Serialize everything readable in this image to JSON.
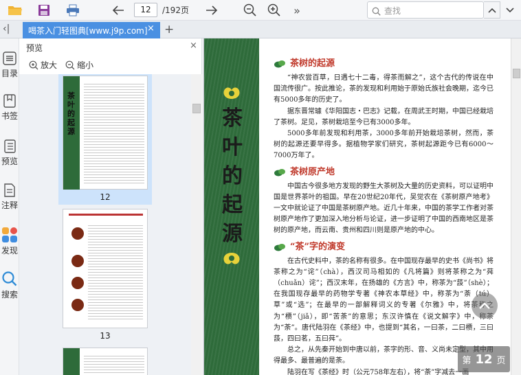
{
  "toolbar": {
    "page_current": "12",
    "page_total": "/192页",
    "search_placeholder": "查找",
    "more": "»"
  },
  "tabs": [
    {
      "label": "喝茶入门轻图典[www.j9p.com]",
      "close": "×"
    }
  ],
  "tab_add": "+",
  "collapse": "‹|",
  "rail": [
    {
      "label": "目录"
    },
    {
      "label": "书签"
    },
    {
      "label": "预览"
    },
    {
      "label": "注释"
    },
    {
      "label": "发现"
    },
    {
      "label": "搜索"
    }
  ],
  "preview": {
    "title": "预览",
    "close": "×",
    "zoom_in": "放大",
    "zoom_out": "缩小",
    "thumbnails": [
      {
        "page": "12"
      },
      {
        "page": "13"
      }
    ]
  },
  "document": {
    "vertical_title": "茶叶的起源",
    "sections": [
      {
        "heading": "茶树的起源",
        "paragraphs": [
          "“神农尝百草，日遇七十二毒，得茶而解之”，这个古代的传说在中国流传很广。按此推论，茶的发现和利用始于原始氏族社会晚期，迄今已有5000多年的历史了。",
          "据东晋常璩《华阳国志・巴志》记载，在周武王时期，中国已经栽培了茶树。足见，茶树栽培至今已有3000多年。",
          "5000多年前发现和利用茶，3000多年前开始栽培茶树，然而，茶树的起源还要早得多。据植物学家们研究，茶树起源距今已有6000～7000万年了。"
        ]
      },
      {
        "heading": "茶树原产地",
        "paragraphs": [
          "中国古今很多地方发现的野生大茶树及大量的历史资料，可以证明中国是世界茶叶的祖国。早在20世纪20年代，吴觉农在《茶树原产地考》一文中就论证了中国是茶树原产地。近几十年来，中国的茶学工作者对茶树原产地作了更加深入地分析与论证，进一步证明了中国的西南地区是茶树的原产地，而云南、贵州和四川则是原产地的中心。"
        ]
      },
      {
        "heading": "“茶”字的演变",
        "paragraphs": [
          "在古代史料中，茶的名称有很多。在中国现存最早的史书《尚书》将茶称之为“诧”（chà），西汉司马相如的《凡将篇》则将茶称之为“荈（chuǎn）诧”；西汉末年，在扬雄的《方言》中，称茶为“蔎”（shè）；在我国现存最早的药物学专著《神农本草经》中，称茶为“荼（tú）草”或“选”；在最早的一部解释词义的专著《尔雅》中，将茶称之为“槚”（jiǎ），即“苦荼”的意思；东汉许慎在《说文解字》中，称茶为“荼”。唐代陆羽在《茶经》中，也提到“其名，一曰茶，二曰槚，三曰蔎，四曰茗，五曰荈”。",
          "总之，从先秦开始到中唐以前，茶字的形、音、义尚未定型，其中用得最多、最普遍的是荼。",
          "陆羽在写《茶经》时（公元758年左右），将“荼”字减去一画"
        ]
      }
    ]
  },
  "page_badge": {
    "prefix": "第",
    "number": "12",
    "suffix": "页"
  },
  "colors": {
    "accent": "#4a90e2",
    "heading_red": "#c0392b",
    "band_green": "#2e6b3a"
  }
}
